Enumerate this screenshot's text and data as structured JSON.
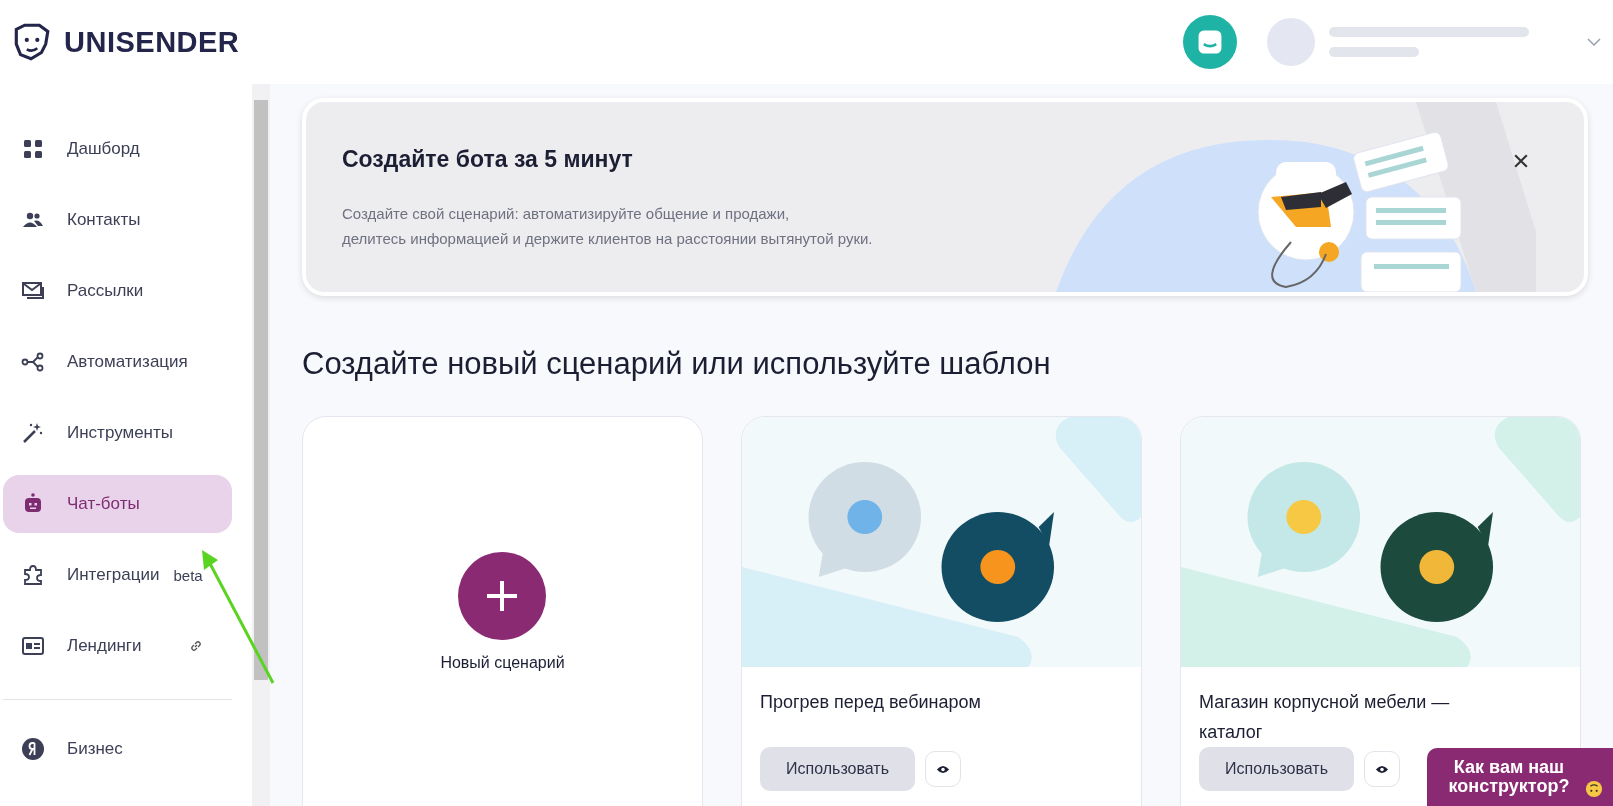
{
  "header": {
    "logo": "UNISENDER"
  },
  "sidebar": {
    "items": [
      {
        "label": "Дашборд",
        "selected": false
      },
      {
        "label": "Контакты",
        "selected": false
      },
      {
        "label": "Рассылки",
        "selected": false
      },
      {
        "label": "Автоматизация",
        "selected": false
      },
      {
        "label": "Инструменты",
        "selected": false
      },
      {
        "label": "Чат-боты",
        "selected": true
      },
      {
        "label": "Интеграции",
        "selected": false,
        "badge": "beta"
      },
      {
        "label": "Лендинги",
        "selected": false,
        "external": true
      }
    ],
    "bottom_items": [
      {
        "label": "Бизнес",
        "selected": false
      }
    ]
  },
  "banner": {
    "title": "Создайте бота за 5 минут",
    "text": "Создайте свой сценарий: автоматизируйте общение и продажи,\nделитесь информацией и держите клиентов на расстоянии вытянутой руки."
  },
  "heading": "Создайте новый сценарий или используйте шаблон",
  "cards": [
    {
      "kind": "new",
      "label": "Новый сценарий"
    },
    {
      "kind": "template",
      "title": "Прогрев перед вебинаром",
      "button": "Использовать"
    },
    {
      "kind": "template",
      "title": "Магазин корпусной мебели — каталог",
      "button": "Использовать"
    }
  ],
  "feedback": {
    "text": "Как вам наш конструктор?"
  }
}
